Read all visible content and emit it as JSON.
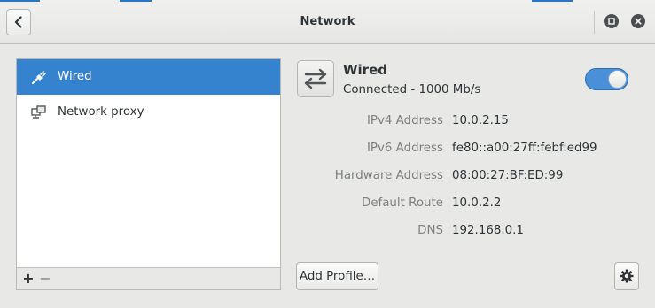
{
  "header": {
    "title": "Network",
    "back_icon": "chevron-left-icon",
    "maximize_icon": "maximize-icon",
    "close_icon": "close-icon"
  },
  "sidebar": {
    "items": [
      {
        "label": "Wired",
        "icon": "ethernet-plug-icon",
        "selected": true
      },
      {
        "label": "Network proxy",
        "icon": "network-proxy-icon",
        "selected": false
      }
    ],
    "add_label": "+",
    "remove_label": "−"
  },
  "device": {
    "name": "Wired",
    "status": "Connected - 1000 Mb/s",
    "icon": "network-transfer-icon",
    "enabled": true,
    "properties": [
      {
        "label": "IPv4 Address",
        "value": "10.0.2.15"
      },
      {
        "label": "IPv6 Address",
        "value": "fe80::a00:27ff:febf:ed99"
      },
      {
        "label": "Hardware Address",
        "value": "08:00:27:BF:ED:99"
      },
      {
        "label": "Default Route",
        "value": "10.0.2.2"
      },
      {
        "label": "DNS",
        "value": "192.168.0.1"
      }
    ],
    "add_profile_label": "Add Profile…",
    "settings_icon": "gear-icon"
  },
  "colors": {
    "accent": "#3582cf",
    "toggle_on": "#4a90d9",
    "label_gray": "#7d8081"
  }
}
